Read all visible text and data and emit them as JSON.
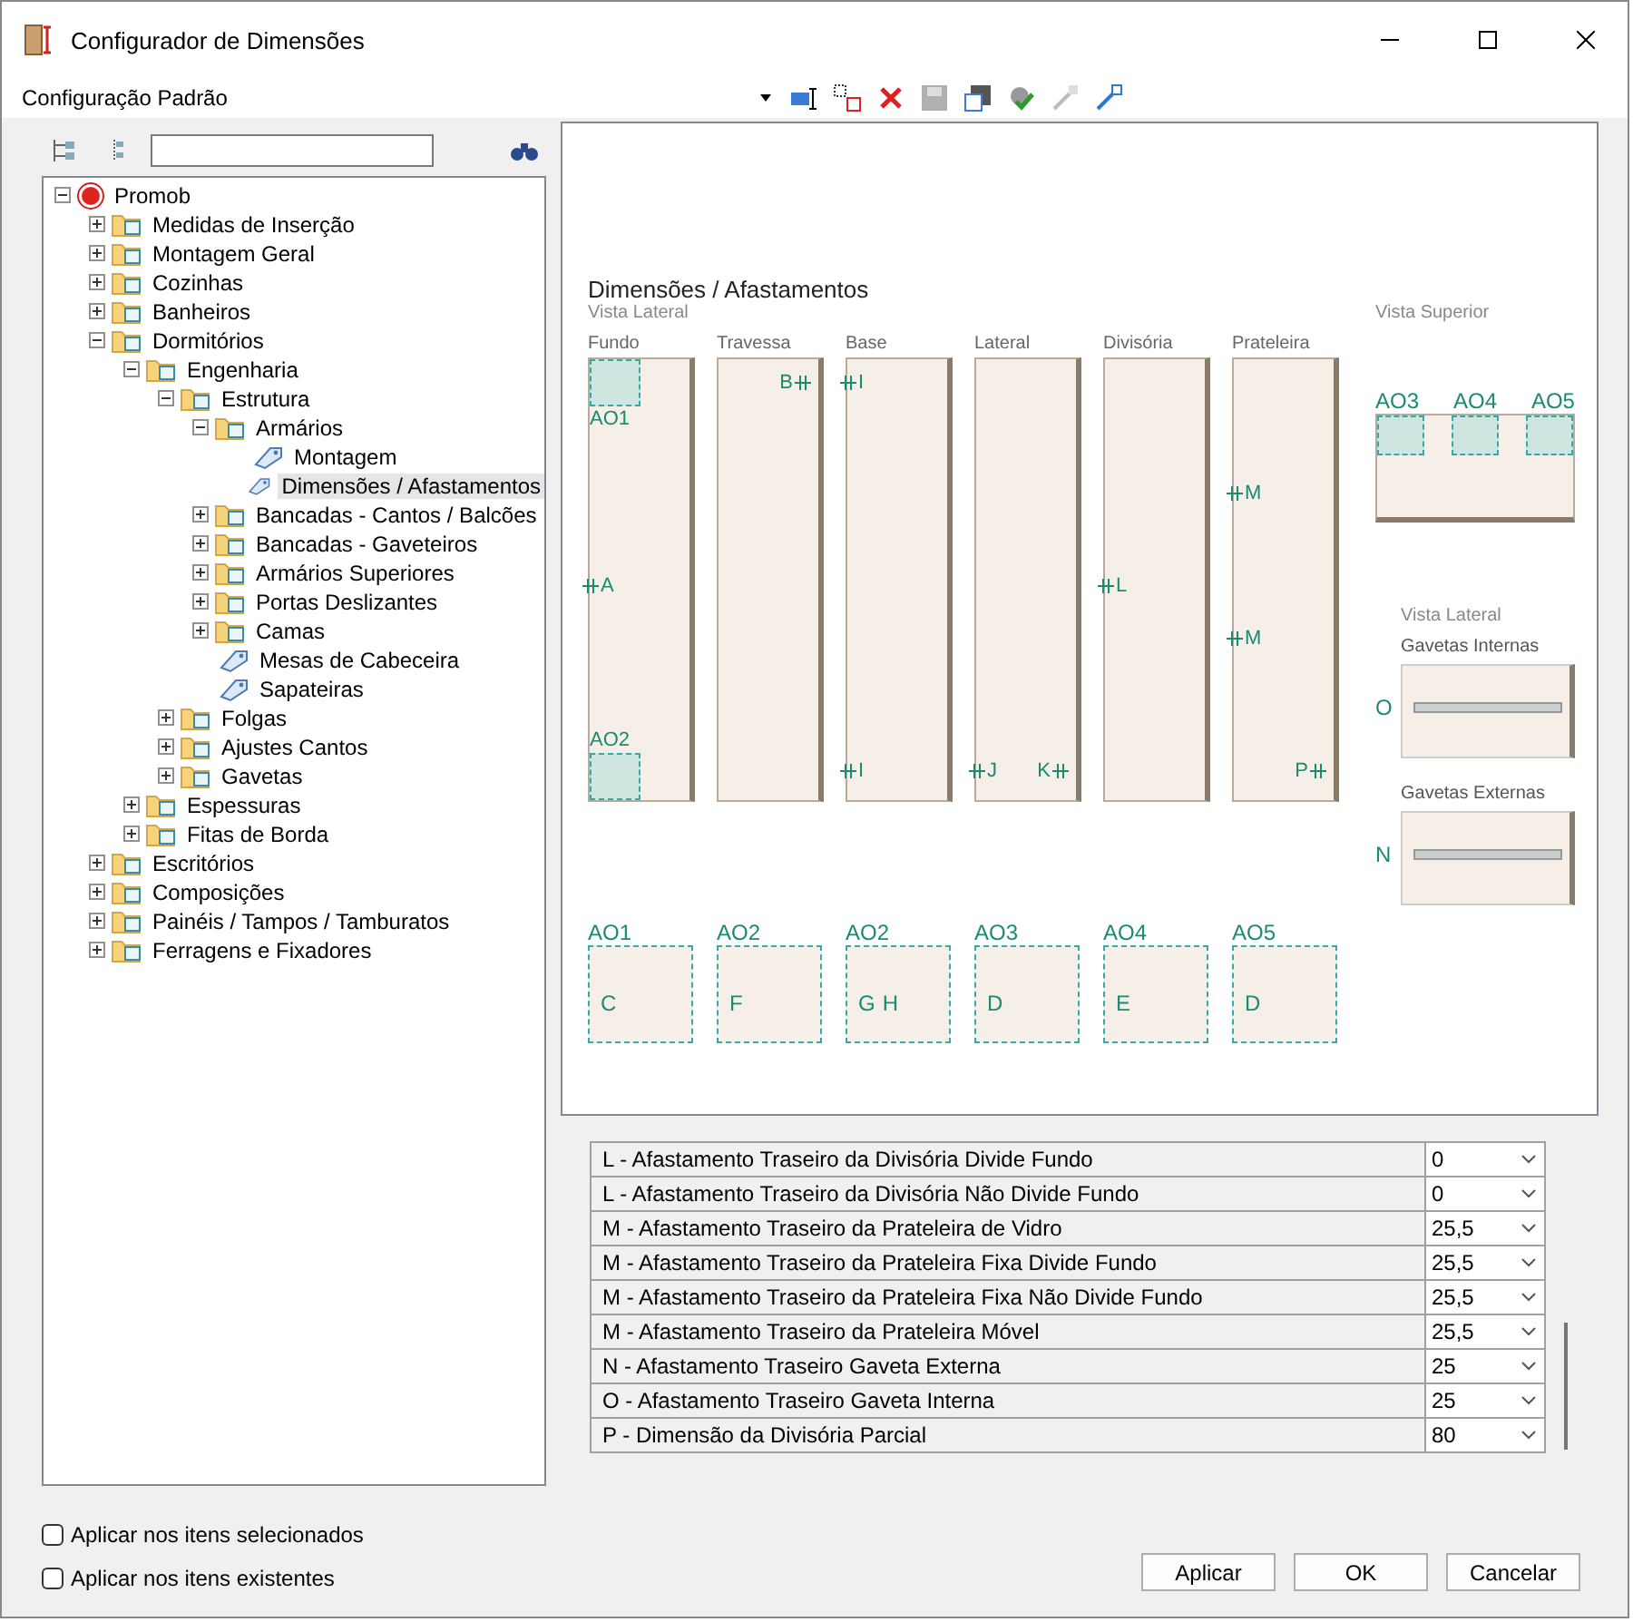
{
  "window": {
    "title": "Configurador de Dimensões"
  },
  "toolbar": {
    "configuration": "Configuração Padrão"
  },
  "tree": [
    {
      "label": "Promob",
      "kind": "root",
      "expanded": true,
      "selected": false,
      "children": [
        {
          "label": "Medidas de Inserção",
          "kind": "folder",
          "expanded": false,
          "selected": false
        },
        {
          "label": "Montagem Geral",
          "kind": "folder",
          "expanded": false,
          "selected": false
        },
        {
          "label": "Cozinhas",
          "kind": "folder",
          "expanded": false,
          "selected": false
        },
        {
          "label": "Banheiros",
          "kind": "folder",
          "expanded": false,
          "selected": false
        },
        {
          "label": "Dormitórios",
          "kind": "folder",
          "expanded": true,
          "selected": false,
          "children": [
            {
              "label": "Engenharia",
              "kind": "folder",
              "expanded": true,
              "selected": false,
              "children": [
                {
                  "label": "Estrutura",
                  "kind": "folder",
                  "expanded": true,
                  "selected": false,
                  "children": [
                    {
                      "label": "Armários",
                      "kind": "folder",
                      "expanded": true,
                      "selected": false,
                      "children": [
                        {
                          "label": "Montagem",
                          "kind": "item",
                          "selected": false
                        },
                        {
                          "label": "Dimensões / Afastamentos",
                          "kind": "item",
                          "selected": true
                        }
                      ]
                    },
                    {
                      "label": "Bancadas - Cantos / Balcões",
                      "kind": "folder",
                      "expanded": false,
                      "selected": false
                    },
                    {
                      "label": "Bancadas - Gaveteiros",
                      "kind": "folder",
                      "expanded": false,
                      "selected": false
                    },
                    {
                      "label": "Armários Superiores",
                      "kind": "folder",
                      "expanded": false,
                      "selected": false
                    },
                    {
                      "label": "Portas Deslizantes",
                      "kind": "folder",
                      "expanded": false,
                      "selected": false
                    },
                    {
                      "label": "Camas",
                      "kind": "folder",
                      "expanded": false,
                      "selected": false
                    },
                    {
                      "label": "Mesas de Cabeceira",
                      "kind": "item",
                      "selected": false
                    },
                    {
                      "label": "Sapateiras",
                      "kind": "item",
                      "selected": false
                    }
                  ]
                },
                {
                  "label": "Folgas",
                  "kind": "folder",
                  "expanded": false,
                  "selected": false
                },
                {
                  "label": "Ajustes Cantos",
                  "kind": "folder",
                  "expanded": false,
                  "selected": false
                },
                {
                  "label": "Gavetas",
                  "kind": "folder",
                  "expanded": false,
                  "selected": false
                }
              ]
            },
            {
              "label": "Espessuras",
              "kind": "folder",
              "expanded": false,
              "selected": false
            },
            {
              "label": "Fitas de Borda",
              "kind": "folder",
              "expanded": false,
              "selected": false
            }
          ]
        },
        {
          "label": "Escritórios",
          "kind": "folder",
          "expanded": false,
          "selected": false
        },
        {
          "label": "Composições",
          "kind": "folder",
          "expanded": false,
          "selected": false
        },
        {
          "label": "Painéis / Tampos / Tamburatos",
          "kind": "folder",
          "expanded": false,
          "selected": false
        },
        {
          "label": "Ferragens e Fixadores",
          "kind": "folder",
          "expanded": false,
          "selected": false
        }
      ]
    }
  ],
  "diagram": {
    "title": "Dimensões / Afastamentos",
    "side_view_label": "Vista Lateral",
    "top_view_label": "Vista Superior",
    "side_panels": [
      {
        "name": "Fundo",
        "marks": [
          {
            "text": "AO1",
            "kind": "topzone"
          },
          {
            "text": "A",
            "kind": "midleft"
          },
          {
            "text": "AO2",
            "kind": "bottomzone"
          }
        ]
      },
      {
        "name": "Travessa",
        "marks": [
          {
            "text": "B",
            "kind": "topright"
          }
        ]
      },
      {
        "name": "Base",
        "marks": [
          {
            "text": "I",
            "kind": "topleft"
          },
          {
            "text": "I",
            "kind": "bottomleft"
          }
        ]
      },
      {
        "name": "Lateral",
        "marks": [
          {
            "text": "J",
            "kind": "bottomleft"
          },
          {
            "text": "K",
            "kind": "bottomright"
          }
        ]
      },
      {
        "name": "Divisória",
        "marks": [
          {
            "text": "L",
            "kind": "midleft"
          }
        ]
      },
      {
        "name": "Prateleira",
        "marks": [
          {
            "text": "M",
            "kind": "upperleft"
          },
          {
            "text": "M",
            "kind": "lowerleft"
          },
          {
            "text": "P",
            "kind": "bottomright"
          }
        ]
      }
    ],
    "top_view_marks": [
      "AO3",
      "AO4",
      "AO5"
    ],
    "drawer_view_label": "Vista Lateral",
    "drawer_views": [
      {
        "name": "Gavetas Internas",
        "mark": "O"
      },
      {
        "name": "Gavetas Externas",
        "mark": "N"
      }
    ],
    "details": [
      {
        "label": "AO1",
        "marks": [
          "C"
        ]
      },
      {
        "label": "AO2",
        "marks": [
          "F"
        ]
      },
      {
        "label": "AO2",
        "marks": [
          "G",
          "H"
        ]
      },
      {
        "label": "AO3",
        "marks": [
          "D"
        ]
      },
      {
        "label": "AO4",
        "marks": [
          "E"
        ]
      },
      {
        "label": "AO5",
        "marks": [
          "D"
        ]
      }
    ]
  },
  "table": {
    "rows": [
      {
        "label": "L - Afastamento Traseiro da Divisória Divide Fundo",
        "value": "0"
      },
      {
        "label": "L - Afastamento Traseiro da Divisória Não Divide Fundo",
        "value": "0"
      },
      {
        "label": "M - Afastamento Traseiro da Prateleira de Vidro",
        "value": "25,5"
      },
      {
        "label": "M - Afastamento Traseiro da Prateleira Fixa Divide Fundo",
        "value": "25,5"
      },
      {
        "label": "M - Afastamento Traseiro da Prateleira Fixa Não Divide Fundo",
        "value": "25,5"
      },
      {
        "label": "M - Afastamento Traseiro da Prateleira Móvel",
        "value": "25,5"
      },
      {
        "label": "N - Afastamento Traseiro Gaveta Externa",
        "value": "25"
      },
      {
        "label": "O - Afastamento Traseiro Gaveta Interna",
        "value": "25"
      },
      {
        "label": "P - Dimensão da Divisória Parcial",
        "value": "80"
      }
    ]
  },
  "options": [
    {
      "label": "Aplicar nos itens selecionados",
      "checked": false
    },
    {
      "label": "Aplicar nos itens existentes",
      "checked": false
    }
  ],
  "buttons": [
    "Aplicar",
    "OK",
    "Cancelar"
  ]
}
